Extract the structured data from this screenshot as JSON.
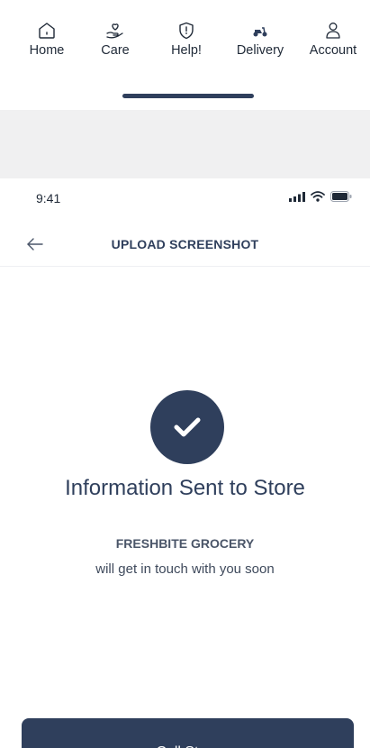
{
  "tabbar": {
    "tabs": [
      {
        "label": "Home",
        "icon": "home-icon"
      },
      {
        "label": "Care",
        "icon": "care-icon"
      },
      {
        "label": "Help!",
        "icon": "help-shield-icon"
      },
      {
        "label": "Delivery",
        "icon": "delivery-scooter-icon"
      },
      {
        "label": "Account",
        "icon": "account-icon"
      }
    ]
  },
  "status": {
    "time": "9:41"
  },
  "header": {
    "title": "UPLOAD SCREENSHOT"
  },
  "confirmation": {
    "headline": "Information Sent to Store",
    "store_name": "FRESHBITE GROCERY",
    "message": "will get in touch with you soon"
  },
  "actions": {
    "call_label": "Call Store"
  },
  "colors": {
    "primary": "#2f3f5c",
    "divider": "#f0f0f1"
  }
}
